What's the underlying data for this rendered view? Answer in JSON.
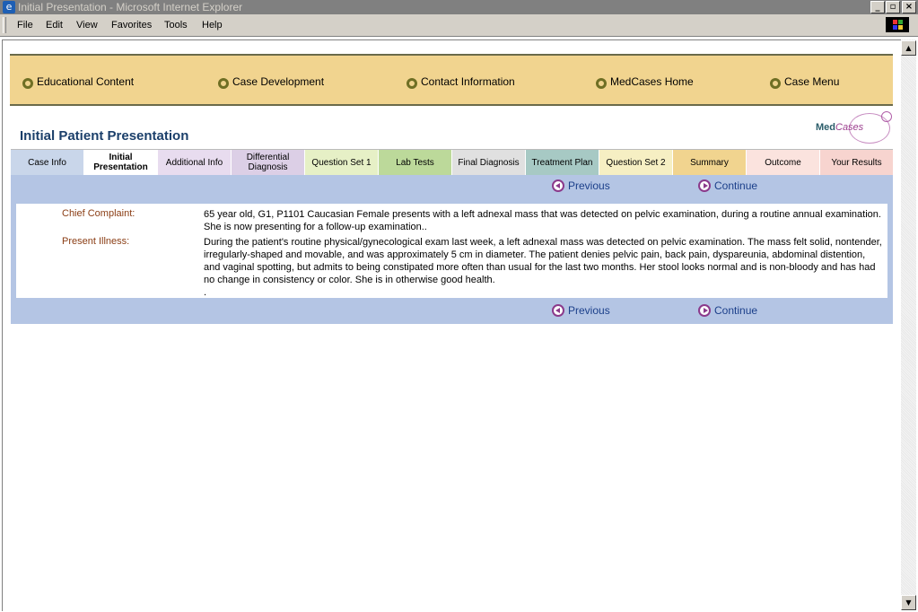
{
  "window": {
    "title": "Initial Presentation - Microsoft Internet Explorer",
    "minimize": "_",
    "maximize": "▫",
    "close": "×"
  },
  "menu": {
    "items": [
      {
        "label": "File"
      },
      {
        "label": "Edit"
      },
      {
        "label": "View"
      },
      {
        "label": "Favorites"
      },
      {
        "label": "Tools"
      },
      {
        "label": "Help"
      }
    ]
  },
  "topnav": {
    "items": [
      {
        "label": "Educational Content"
      },
      {
        "label": "Case Development"
      },
      {
        "label": "Contact Information"
      },
      {
        "label": "MedCases Home"
      },
      {
        "label": "Case Menu"
      }
    ]
  },
  "page": {
    "title": "Initial Patient Presentation",
    "logo_med": "Med",
    "logo_cases": "Cases"
  },
  "tabs": [
    {
      "label": "Case Info",
      "color": "#c9d6ea"
    },
    {
      "label": "Initial Presentation",
      "color": "#ffffff"
    },
    {
      "label": "Additional Info",
      "color": "#e8dcef"
    },
    {
      "label": "Differential Diagnosis",
      "color": "#dccfe6"
    },
    {
      "label": "Question Set 1",
      "color": "#e6f0c6"
    },
    {
      "label": "Lab Tests",
      "color": "#bcd99a"
    },
    {
      "label": "Final Diagnosis",
      "color": "#e0e0e0"
    },
    {
      "label": "Treatment Plan",
      "color": "#a7c9c4"
    },
    {
      "label": "Question Set 2",
      "color": "#f6efc3"
    },
    {
      "label": "Summary",
      "color": "#f1d48f"
    },
    {
      "label": "Outcome",
      "color": "#fbe3de"
    },
    {
      "label": "Your Results",
      "color": "#f7d4cf"
    }
  ],
  "nav": {
    "previous": "Previous",
    "continue": "Continue"
  },
  "case": {
    "chief_complaint_label": "Chief Complaint:",
    "chief_complaint_text": "65 year old, G1, P1101 Caucasian Female presents with a left adnexal mass that was detected on pelvic examination, during a routine annual examination. She is now presenting for a follow-up examination..",
    "present_illness_label": "Present Illness:",
    "present_illness_text": "During the patient's routine physical/gynecological exam last week, a left adnexal mass was detected on pelvic examination.  The mass felt solid, nontender, irregularly-shaped and movable, and was approximately 5 cm in diameter.  The patient denies pelvic pain, back pain, dyspareunia, abdominal distention, and vaginal spotting, but admits to being constipated more often than usual for the last two months.  Her stool looks normal and is non-bloody and has had no change in consistency or color.  She is in otherwise good health.",
    "trailing": "."
  }
}
